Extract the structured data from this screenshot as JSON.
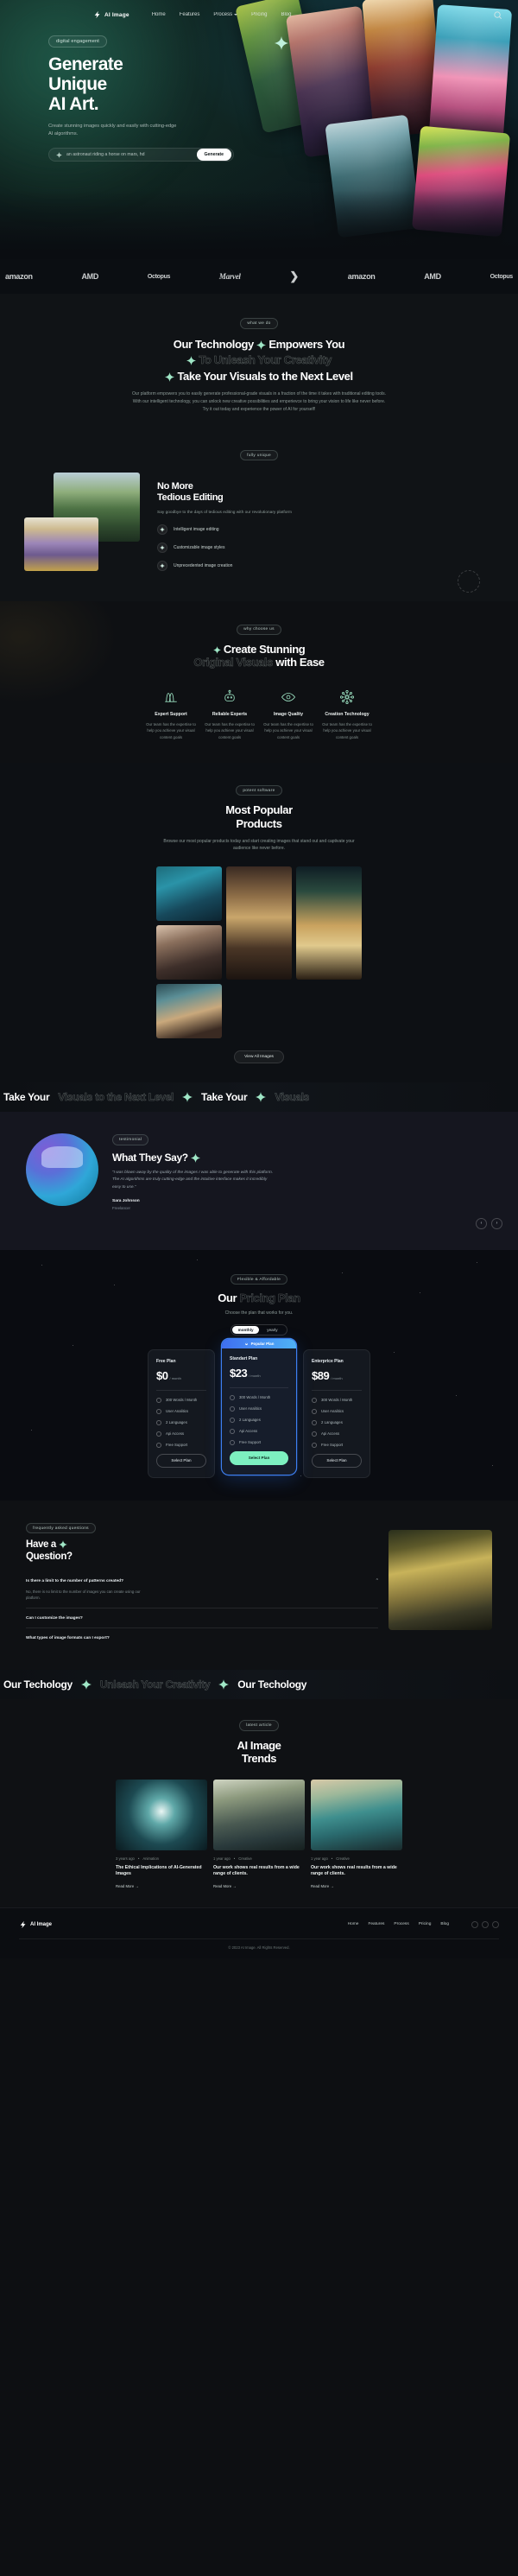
{
  "brand": {
    "name": "AI Image",
    "logo_icon": "lightning-logo-icon"
  },
  "nav": {
    "items": [
      {
        "label": "Home",
        "icon": ""
      },
      {
        "label": "Features",
        "icon": ""
      },
      {
        "label": "Process",
        "icon": "chevron-down-icon"
      },
      {
        "label": "Pricing",
        "icon": ""
      },
      {
        "label": "Blog",
        "icon": ""
      }
    ],
    "search_icon": "search-icon"
  },
  "hero": {
    "pill": "digital engagement",
    "title_line1": "Generate",
    "title_line2": "Unique",
    "title_line3": "AI Art.",
    "subtitle": "Create stunning images quickly and easily with cutting-edge AI algorithms.",
    "search_placeholder": "an astronaut riding a horse on mars, hd",
    "search_value": "an astronaut riding a horse on mars, hd",
    "cta_label": "Generate",
    "spark_icon": "sparkle-icon"
  },
  "logos": {
    "items": [
      "amazon",
      "AMD",
      "Octopus",
      "Marvel",
      "Nike",
      "amazon",
      "AMD",
      "Octopus"
    ]
  },
  "technology": {
    "tag": "what we do",
    "line1": "Our Technology",
    "line1_b": "Empowers You",
    "line2": "To Unleash Your Creativity",
    "line3": "Take Your Visuals to the Next Level",
    "paragraph": "Our platform empowers you to easily generate professional-grade visuals in a fraction of the time it takes with traditional editing tools. With our intelligent technology, you can unlock new creative possibilities and ernperievce to bring your vision to life like never before. Try it out today and experience the power of AI for yourself!"
  },
  "tedious": {
    "tag": "fully unique",
    "title_line1": "No More",
    "title_line2": "Tedious Editing",
    "paragraph": "Say goodbye to the days of tedious editing with our revolutionary platform",
    "features": [
      {
        "label": "Intelligent image editing",
        "icon": "sparkle-icon"
      },
      {
        "label": "Customizable image styles",
        "icon": "sparkle-icon"
      },
      {
        "label": "Unprecedented image creation",
        "icon": "sparkle-icon"
      }
    ]
  },
  "stunning": {
    "tag": "why choose us",
    "title_line1": "Create Stunning",
    "title_line2_outline": "Original Visuals",
    "title_line2_solid": "with Ease",
    "cards": [
      {
        "title": "Expert Support",
        "icon": "waves-icon",
        "text": "Our team has the expertise to help you achieve your visual content goals"
      },
      {
        "title": "Reliable Experts",
        "icon": "robot-icon",
        "text": "Our team has the expertise to help you achieve your visual content goals"
      },
      {
        "title": "Image Quality",
        "icon": "eye-icon",
        "text": "Our team has the expertise to help you achieve your visual content goals"
      },
      {
        "title": "Creation Technology",
        "icon": "network-icon",
        "text": "Our team has the expertise to help you achieve your visual content goals"
      }
    ]
  },
  "products": {
    "tag": "potent software",
    "title_line1": "Most Popular",
    "title_line2": "Products",
    "paragraph": "Browse our most popular products today and start creating images that stand out and captivate your audience like never before.",
    "view_all_label": "View All Images"
  },
  "marquee": {
    "items": [
      "Take Your",
      "Visuals to the Next Level",
      "Take Your",
      "Visuals"
    ],
    "separator_icon": "sparkle-icon"
  },
  "testimonial": {
    "tag": "testimonial",
    "title": "What They Say?",
    "spark_icon": "sparkle-icon",
    "quote": "“I was blown away by the quality of the images I was able to generate with this platform. The AI algorithms are truly cutting-edge and the intuitive interface makes it incredibly easy to use.”",
    "name": "Sara Johnson",
    "role": "Freelancer",
    "prev_icon": "chevron-left-icon",
    "next_icon": "chevron-right-icon"
  },
  "pricing": {
    "tag": "Flexible & Affordable",
    "title_solid": "Our",
    "title_outline": "Pricing Plan",
    "subtitle": "Choose the plan that works for you.",
    "toggle": {
      "monthly": "monthly",
      "yearly": "yearly",
      "active": "monthly"
    },
    "popular_badge": "Popular Plan",
    "popular_badge_icon": "fire-icon",
    "plans": [
      {
        "name": "Free Plan",
        "price": "$0",
        "period": "/ month",
        "features": [
          "300 Words / Month",
          "User Analitics",
          "2 Languages",
          "Api Access",
          "Free Support"
        ],
        "button": "Select Plan",
        "highlighted": false
      },
      {
        "name": "Standart Plan",
        "price": "$23",
        "period": "/ month",
        "features": [
          "300 Words / Month",
          "User Analitics",
          "2 Languages",
          "Api Access",
          "Free Support"
        ],
        "button": "Select Plan",
        "highlighted": true
      },
      {
        "name": "Enterprice Plan",
        "price": "$89",
        "period": "/ month",
        "features": [
          "300 Words / Month",
          "User Analitics",
          "2 Languages",
          "Api Access",
          "Free Support"
        ],
        "button": "Select Plan",
        "highlighted": false
      }
    ]
  },
  "faq": {
    "tag": "frequently asked questions",
    "title_line1": "Have a",
    "title_line2": "Question?",
    "spark_icon": "sparkle-icon",
    "items": [
      {
        "question": "Is there a limit to the number of patterns created?",
        "answer": "No, there is no limit to the number of images you can create using our platform.",
        "open": true
      },
      {
        "question": "Can I customize the images?",
        "answer": "",
        "open": false
      },
      {
        "question": "What types of image formats can I export?",
        "answer": "",
        "open": false
      }
    ]
  },
  "marquee2": {
    "items": [
      "Our Techology",
      "Unleash Your Creativity",
      "Our Techology"
    ],
    "separator_icon": "sparkle-icon"
  },
  "trends": {
    "tag": "latest article",
    "title_line1": "AI Image",
    "title_line2": "Trends",
    "posts": [
      {
        "date": "3 years ago",
        "category": "Animation",
        "title": "The Ethical Implications of AI-Generated Images",
        "more": "Read More"
      },
      {
        "date": "1 year ago",
        "category": "Creative",
        "title": "Our work shows real results from a wide range of clients.",
        "more": "Read More"
      },
      {
        "date": "1 year ago",
        "category": "Creative",
        "title": "Our work shows real results from a wide range of clients.",
        "more": "Read More"
      }
    ]
  },
  "footer": {
    "brand": "AI Image",
    "links": [
      "Home",
      "Features",
      "Process",
      "Pricing",
      "Blog"
    ],
    "socials": [
      "facebook-icon",
      "twitter-icon",
      "instagram-icon"
    ],
    "copyright": "© 2023 AI Image. All Rights Reserved."
  },
  "colors": {
    "accent_green": "#7df0c0",
    "accent_blue": "#3d7ff0",
    "bg": "#0d0f12",
    "text": "#ffffff"
  }
}
